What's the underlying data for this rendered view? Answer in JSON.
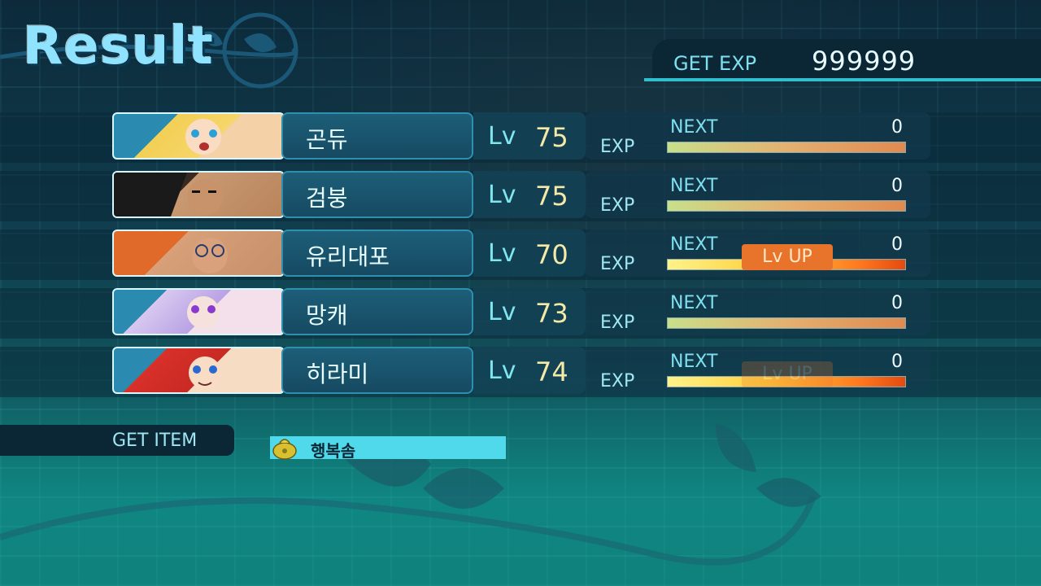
{
  "screen_title": "Result",
  "get_exp": {
    "label": "GET EXP",
    "value": "999999"
  },
  "party": [
    {
      "name": "곤듀",
      "lv_label": "Lv",
      "level": "75",
      "exp_label": "EXP",
      "next_label": "NEXT",
      "next_value": "0",
      "bar_fill": 1.0,
      "level_up": false,
      "portrait": "blonde-girl-portrait"
    },
    {
      "name": "검붕",
      "lv_label": "Lv",
      "level": "75",
      "exp_label": "EXP",
      "next_label": "NEXT",
      "next_value": "0",
      "bar_fill": 1.0,
      "level_up": false,
      "portrait": "dark-haired-man-portrait"
    },
    {
      "name": "유리대포",
      "lv_label": "Lv",
      "level": "70",
      "exp_label": "EXP",
      "next_label": "NEXT",
      "next_value": "0",
      "bar_fill": 1.0,
      "level_up": true,
      "level_up_label": "Lv UP",
      "portrait": "glasses-man-portrait"
    },
    {
      "name": "망캐",
      "lv_label": "Lv",
      "level": "73",
      "exp_label": "EXP",
      "next_label": "NEXT",
      "next_value": "0",
      "bar_fill": 1.0,
      "level_up": false,
      "portrait": "purple-haired-girl-portrait"
    },
    {
      "name": "히라미",
      "lv_label": "Lv",
      "level": "74",
      "exp_label": "EXP",
      "next_label": "NEXT",
      "next_value": "0",
      "bar_fill": 1.0,
      "level_up": true,
      "level_up_label": "Lv UP",
      "level_up_faded": true,
      "portrait": "red-haired-girl-portrait"
    }
  ],
  "get_item": {
    "label": "GET ITEM",
    "items": [
      {
        "name": "행복솜",
        "icon": "money-bag-icon"
      }
    ]
  },
  "colors": {
    "accent": "#7ee0ef",
    "level_number": "#f4e9a6",
    "lvup": "#e8742c",
    "item_bar": "#4fd9ea"
  }
}
